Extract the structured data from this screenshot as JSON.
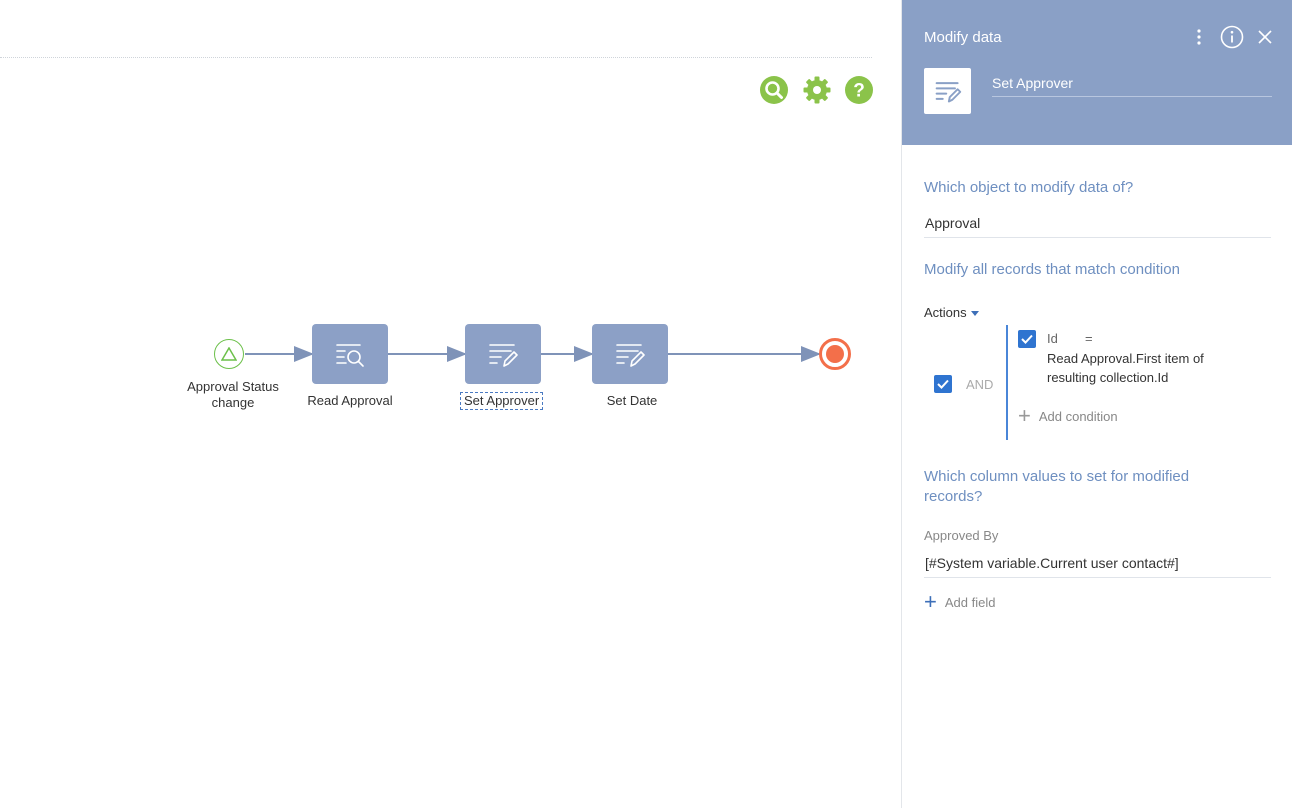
{
  "canvas": {
    "tools": [
      {
        "name": "search-icon",
        "color": "#8bc34a"
      },
      {
        "name": "gear-icon",
        "color": "#8bc34a"
      },
      {
        "name": "help-icon",
        "color": "#8bc34a"
      }
    ]
  },
  "diagram": {
    "start": {
      "label_line1": "Approval Status",
      "label_line2": "change"
    },
    "tasks": [
      {
        "label": "Read Approval",
        "icon": "read-data-icon"
      },
      {
        "label": "Set Approver",
        "icon": "modify-data-icon",
        "selected": true
      },
      {
        "label": "Set Date",
        "icon": "modify-data-icon"
      }
    ],
    "end": {
      "icon": "end-event-icon"
    },
    "colors": {
      "task": "#8ca0c6",
      "start": "#6cc04a",
      "end": "#f36f4a",
      "flow": "#7f93b8"
    }
  },
  "panel": {
    "title": "Modify data",
    "element_name": "Set Approver",
    "q_object": "Which object to modify data of?",
    "object_value": "Approval",
    "q_condition": "Modify all records that match condition",
    "actions_label": "Actions",
    "group_operator": "AND",
    "condition": {
      "column": "Id",
      "operator": "=",
      "value": "Read Approval.First item of resulting collection.Id"
    },
    "add_condition_label": "Add condition",
    "q_columns_line1": "Which column values to set for modified",
    "q_columns_line2": "records?",
    "field_caption": "Approved By",
    "field_value": "[#System variable.Current user contact#]",
    "add_field_label": "Add field",
    "colors": {
      "header": "#8aa0c6",
      "accent": "#2f74d0",
      "question": "#6e8fc0"
    }
  }
}
